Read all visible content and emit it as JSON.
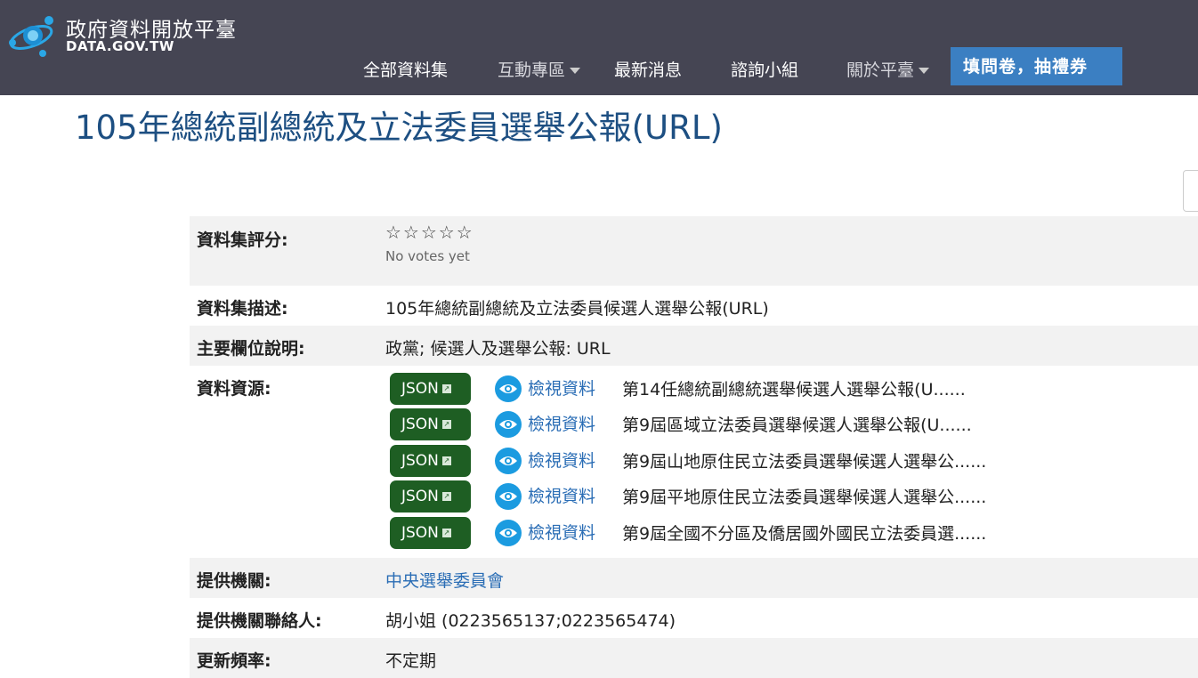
{
  "site": {
    "title": "政府資料開放平臺",
    "subtitle": "DATA.GOV.TW"
  },
  "nav": {
    "items": [
      {
        "label": "全部資料集",
        "dropdown": false
      },
      {
        "label": "互動專區",
        "dropdown": true
      },
      {
        "label": "最新消息",
        "dropdown": false
      },
      {
        "label": "諮詢小組",
        "dropdown": false
      },
      {
        "label": "關於平臺",
        "dropdown": true
      }
    ],
    "cta": "填問卷，抽禮券"
  },
  "page": {
    "title": "105年總統副總統及立法委員選舉公報(URL)"
  },
  "details": {
    "rating_label": "資料集評分:",
    "rating_stars": "☆☆☆☆☆",
    "rating_text": "No votes yet",
    "description_label": "資料集描述:",
    "description_value": "105年總統副總統及立法委員候選人選舉公報(URL)",
    "fields_label": "主要欄位說明:",
    "fields_value": "政黨; 候選人及選舉公報: URL",
    "resources_label": "資料資源:",
    "resources": [
      {
        "format": "JSON",
        "view": "檢視資料",
        "name": "第14任總統副總統選舉候選人選舉公報(U......"
      },
      {
        "format": "JSON",
        "view": "檢視資料",
        "name": "第9屆區域立法委員選舉候選人選舉公報(U......"
      },
      {
        "format": "JSON",
        "view": "檢視資料",
        "name": "第9屆山地原住民立法委員選舉候選人選舉公......"
      },
      {
        "format": "JSON",
        "view": "檢視資料",
        "name": "第9屆平地原住民立法委員選舉候選人選舉公......"
      },
      {
        "format": "JSON",
        "view": "檢視資料",
        "name": "第9屆全國不分區及僑居國外國民立法委員選......"
      }
    ],
    "provider_label": "提供機關:",
    "provider_value": "中央選舉委員會",
    "contact_label": "提供機關聯絡人:",
    "contact_value": "胡小姐 (0223565137;0223565474)",
    "frequency_label": "更新頻率:",
    "frequency_value": "不定期"
  },
  "colors": {
    "header_bg": "#454553",
    "cta_bg": "#3b7fc2",
    "title_color": "#1d4f82",
    "json_button": "#1e5e23",
    "eye_icon": "#1b9be0",
    "link": "#2a6db5"
  },
  "icons": [
    "logo-icon",
    "star-icon",
    "external-link-icon",
    "eye-icon",
    "caret-down-icon"
  ]
}
